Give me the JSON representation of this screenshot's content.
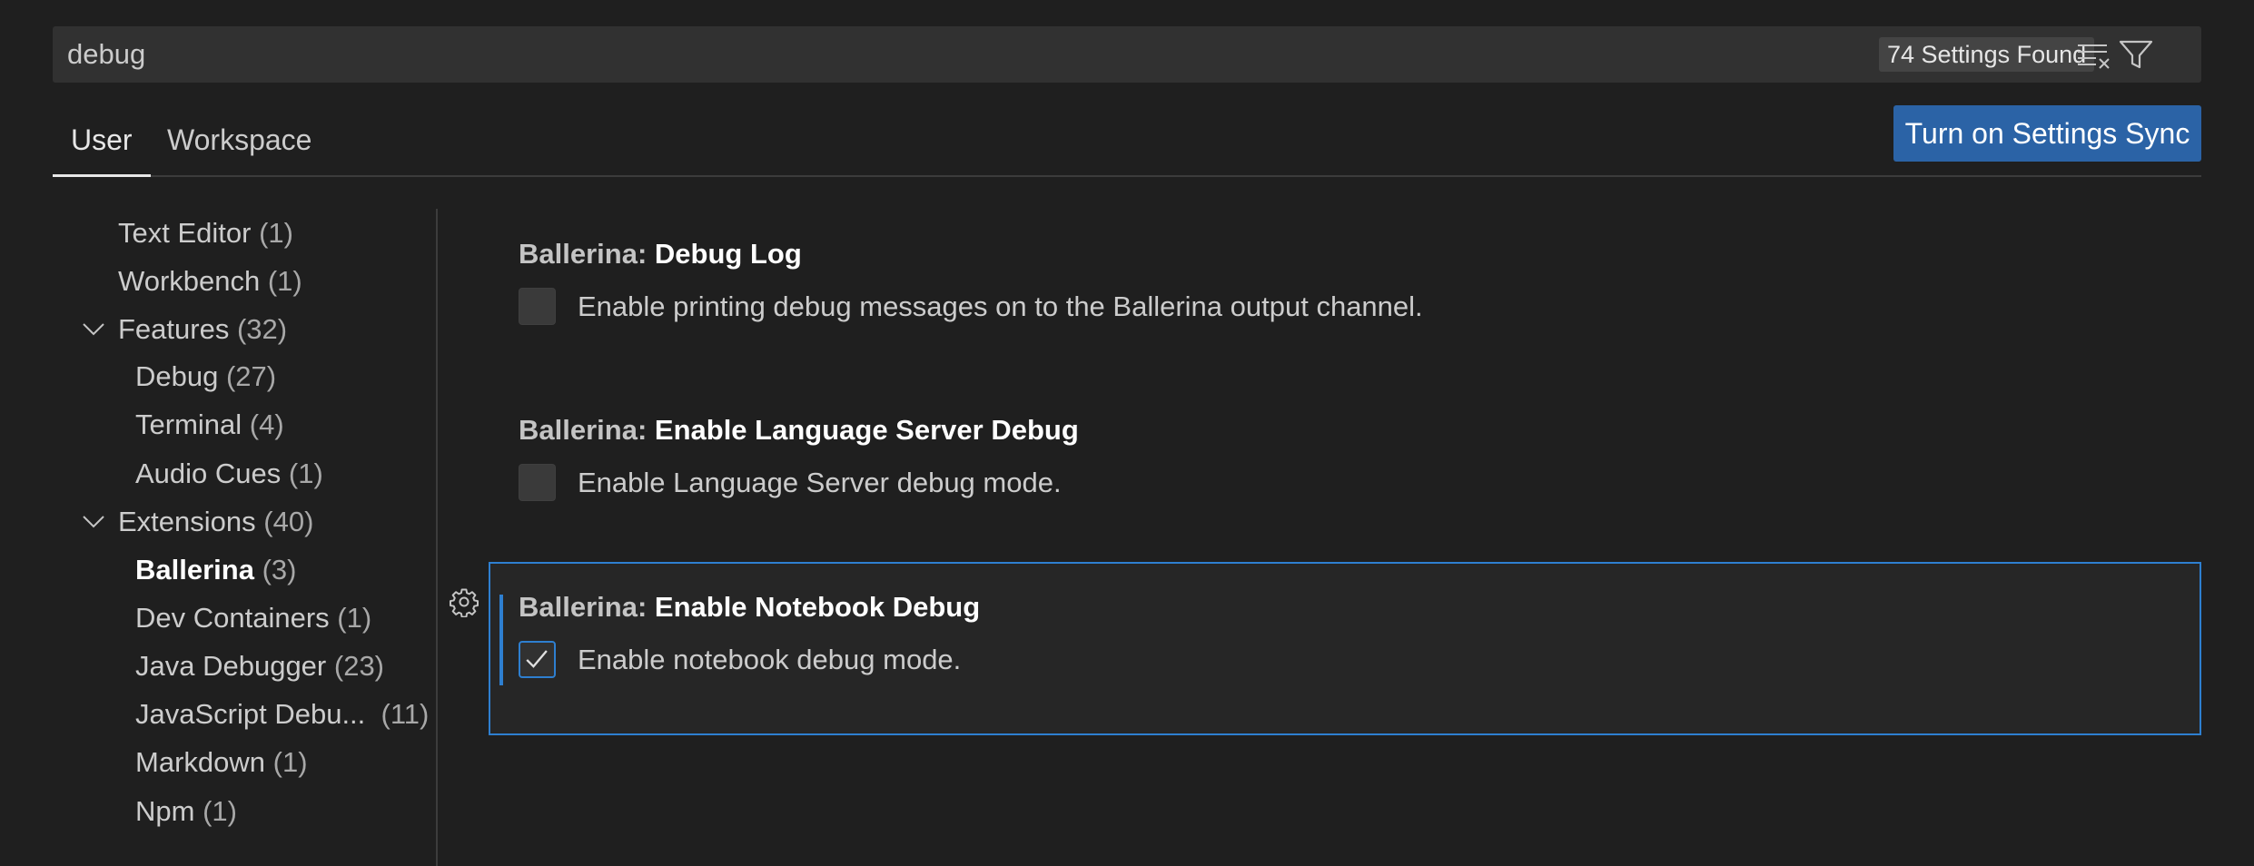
{
  "search": {
    "value": "debug",
    "results_count": "74 Settings Found",
    "clear_icon": "clear-filter-icon",
    "filter_icon": "filter-icon"
  },
  "tabs": [
    {
      "label": "User",
      "active": true
    },
    {
      "label": "Workspace",
      "active": false
    }
  ],
  "sync_button": {
    "label": "Turn on Settings Sync"
  },
  "toc": {
    "items": [
      {
        "name": "Text Editor",
        "count": "(1)"
      },
      {
        "name": "Workbench",
        "count": "(1)"
      },
      {
        "name": "Features",
        "count": "(32)",
        "expanded": true
      },
      {
        "name": "Debug",
        "count": "(27)"
      },
      {
        "name": "Terminal",
        "count": "(4)"
      },
      {
        "name": "Audio Cues",
        "count": "(1)"
      },
      {
        "name": "Extensions",
        "count": "(40)",
        "expanded": true
      },
      {
        "name": "Ballerina",
        "count": "(3)",
        "active": true
      },
      {
        "name": "Dev Containers",
        "count": "(1)"
      },
      {
        "name": "Java Debugger",
        "count": "(23)"
      },
      {
        "name": "JavaScript Debu...",
        "count": "(11)"
      },
      {
        "name": "Markdown",
        "count": "(1)"
      },
      {
        "name": "Npm",
        "count": "(1)"
      }
    ]
  },
  "settings": [
    {
      "category": "Ballerina:",
      "label": "Debug Log",
      "description": "Enable printing debug messages on to the Ballerina output channel.",
      "checked": false
    },
    {
      "category": "Ballerina:",
      "label": "Enable Language Server Debug",
      "description": "Enable Language Server debug mode.",
      "checked": false
    },
    {
      "category": "Ballerina:",
      "label": "Enable Notebook Debug",
      "description": "Enable notebook debug mode.",
      "checked": true
    }
  ],
  "colors": {
    "background": "#1f1f1f",
    "accent": "#2e7fd0",
    "sync_button": "#2b63a6"
  }
}
